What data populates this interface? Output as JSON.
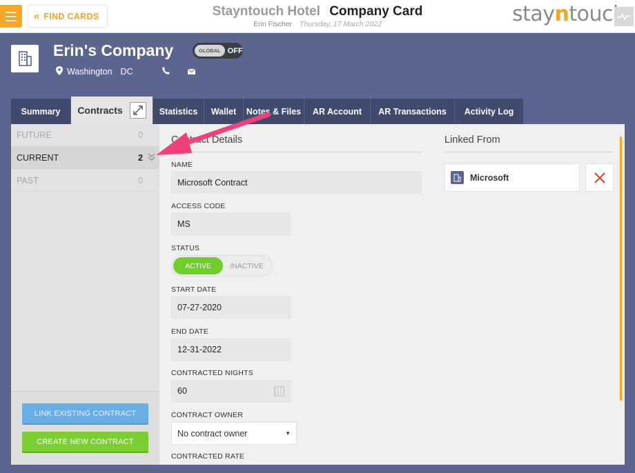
{
  "topbar": {
    "find_cards_label": "FIND CARDS",
    "hotel_name": "Stayntouch Hotel",
    "card_title": "Company Card",
    "user_name": "Erin Fischer",
    "date": "Thursday, 17 March 2022",
    "logo": {
      "pre": "stay",
      "accent": "n",
      "post": "touch"
    }
  },
  "company": {
    "name": "Erin's Company",
    "global_toggle": {
      "knob": "GLOBAL",
      "state": "OFF"
    },
    "city": "Washington",
    "state": "DC"
  },
  "tabs": [
    {
      "label": "Summary"
    },
    {
      "label": "Contracts"
    },
    {
      "label": "Statistics"
    },
    {
      "label": "Wallet"
    },
    {
      "label": "Notes & Files"
    },
    {
      "label": "AR Account"
    },
    {
      "label": "AR Transactions"
    },
    {
      "label": "Activity Log"
    }
  ],
  "contract_categories": [
    {
      "label": "FUTURE",
      "count": "0"
    },
    {
      "label": "CURRENT",
      "count": "2"
    },
    {
      "label": "PAST",
      "count": "0"
    }
  ],
  "left_buttons": {
    "link_existing": "LINK EXISTING CONTRACT",
    "create_new": "CREATE NEW CONTRACT"
  },
  "contract_details": {
    "title": "Contract Details",
    "name_label": "NAME",
    "name_value": "Microsoft Contract",
    "access_code_label": "ACCESS CODE",
    "access_code_value": "MS",
    "status_label": "STATUS",
    "status_active": "ACTIVE",
    "status_inactive": "INACTIVE",
    "start_date_label": "START DATE",
    "start_date_value": "07-27-2020",
    "end_date_label": "END DATE",
    "end_date_value": "12-31-2022",
    "contracted_nights_label": "CONTRACTED NIGHTS",
    "contracted_nights_value": "60",
    "contract_owner_label": "CONTRACT OWNER",
    "contract_owner_value": "No contract owner",
    "contracted_rate_label": "CONTRACTED RATE"
  },
  "linked_from": {
    "title": "Linked From",
    "item": "Microsoft"
  },
  "colors": {
    "accent_orange": "#f5a623",
    "nav_blue": "#3f4a6d",
    "background": "#5b6590",
    "active_green": "#6fcf28",
    "annotation_pink": "#f0407a",
    "remove_red": "#e53935"
  }
}
